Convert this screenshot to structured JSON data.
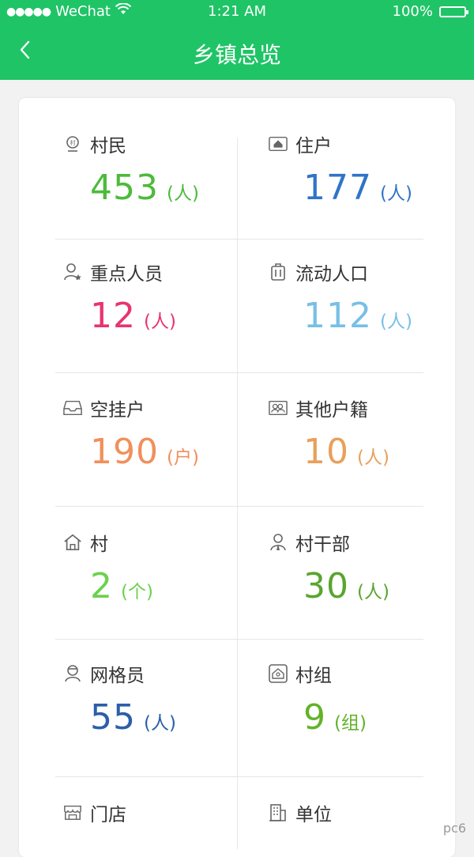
{
  "status_bar": {
    "signal_dots": "●●●●●",
    "carrier": "WeChat",
    "time": "1:21 AM",
    "battery": "100%"
  },
  "nav": {
    "title": "乡镇总览"
  },
  "colors": {
    "header_bg": "#1fc466"
  },
  "stats": [
    {
      "label": "村民",
      "value": "453",
      "unit": "(人)",
      "color": "#4cbb3a",
      "icon": "villager-icon"
    },
    {
      "label": "住户",
      "value": "177",
      "unit": "(人)",
      "color": "#2f74c9",
      "icon": "house-icon"
    },
    {
      "label": "重点人员",
      "value": "12",
      "unit": "(人)",
      "color": "#e8346f",
      "icon": "key-person-icon"
    },
    {
      "label": "流动人口",
      "value": "112",
      "unit": "(人)",
      "color": "#78bfe6",
      "icon": "luggage-icon"
    },
    {
      "label": "空挂户",
      "value": "190",
      "unit": "(户)",
      "color": "#f0905c",
      "icon": "inbox-icon"
    },
    {
      "label": "其他户籍",
      "value": "10",
      "unit": "(人)",
      "color": "#e8a05c",
      "icon": "id-card-icon"
    },
    {
      "label": "村",
      "value": "2",
      "unit": "(个)",
      "color": "#6cd14e",
      "icon": "village-home-icon"
    },
    {
      "label": "村干部",
      "value": "30",
      "unit": "(人)",
      "color": "#5aa52e",
      "icon": "cadre-icon"
    },
    {
      "label": "网格员",
      "value": "55",
      "unit": "(人)",
      "color": "#2b5fa8",
      "icon": "grid-worker-icon"
    },
    {
      "label": "村组",
      "value": "9",
      "unit": "(组)",
      "color": "#62b22a",
      "icon": "village-group-icon"
    },
    {
      "label": "门店",
      "value": "",
      "unit": "",
      "color": "#333333",
      "icon": "store-icon"
    },
    {
      "label": "单位",
      "value": "",
      "unit": "",
      "color": "#333333",
      "icon": "building-icon"
    }
  ],
  "watermark": "pc6"
}
